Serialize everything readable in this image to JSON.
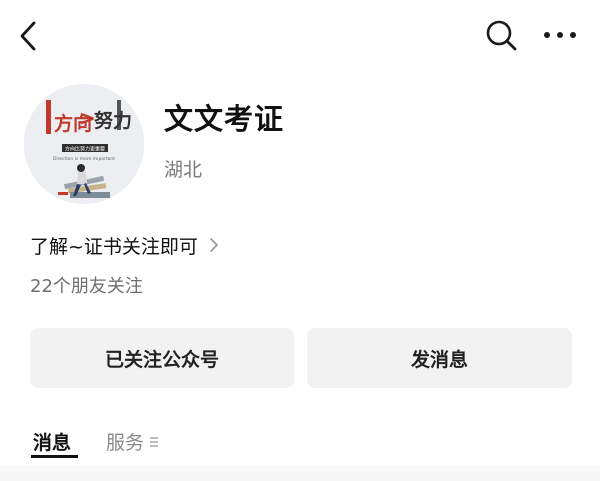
{
  "header": {
    "back_icon": "chevron-left-icon",
    "search_icon": "search-icon",
    "more_icon": "more-horizontal-icon"
  },
  "profile": {
    "name": "文文考证",
    "region": "湖北",
    "avatar": {
      "left_word": "方向",
      "symbol": ">",
      "right_word": "努力",
      "banner": "方向比努力更重要",
      "tagline": "Direction is more important"
    }
  },
  "intro": {
    "text": "了解~证书关注即可"
  },
  "followers_text": "22个朋友关注",
  "actions": {
    "followed_label": "已关注公众号",
    "message_label": "发消息"
  },
  "tabs": {
    "messages": "消息",
    "services": "服务"
  },
  "colors": {
    "button_bg": "#f2f2f2",
    "avatar_accent": "#c0392b",
    "muted_text": "#7b7b7b"
  }
}
